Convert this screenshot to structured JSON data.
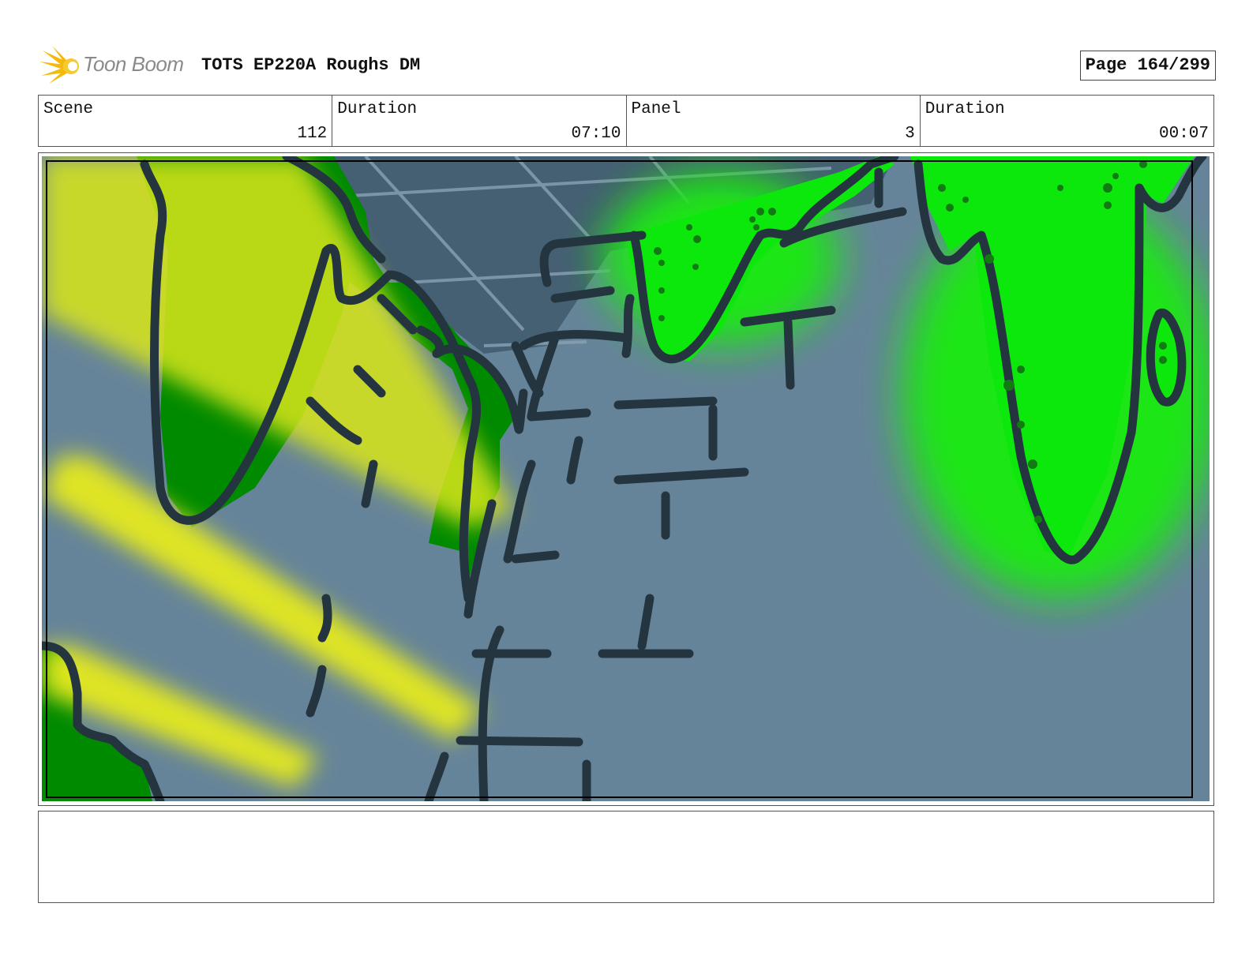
{
  "header": {
    "logo_text": "Toon Boom",
    "title": "TOTS EP220A Roughs DM",
    "page_label": "Page 164/299"
  },
  "info": {
    "scene_label": "Scene",
    "scene_value": "112",
    "scene_duration_label": "Duration",
    "scene_duration_value": "07:10",
    "panel_label": "Panel",
    "panel_value": "3",
    "panel_duration_label": "Duration",
    "panel_duration_value": "00:07"
  },
  "notes": {
    "text": ""
  },
  "colors": {
    "sky": "#668499",
    "ceiling": "#455f73",
    "slime_green": "#1fe619",
    "dark_green": "#008a00",
    "light_beam": "#e0e619",
    "outline": "#24353f",
    "logo_accent": "#f5b90a"
  }
}
